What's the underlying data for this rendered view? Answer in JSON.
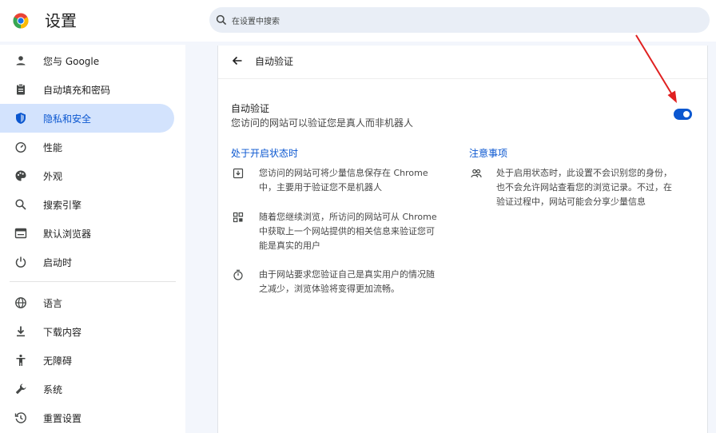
{
  "header": {
    "title": "设置",
    "search_placeholder": "在设置中搜索"
  },
  "sidebar": {
    "items": [
      {
        "label": "您与 Google",
        "icon": "person-icon"
      },
      {
        "label": "自动填充和密码",
        "icon": "clipboard-icon"
      },
      {
        "label": "隐私和安全",
        "icon": "shield-icon",
        "active": true
      },
      {
        "label": "性能",
        "icon": "speedometer-icon"
      },
      {
        "label": "外观",
        "icon": "palette-icon"
      },
      {
        "label": "搜索引擎",
        "icon": "search-icon"
      },
      {
        "label": "默认浏览器",
        "icon": "browser-window-icon"
      },
      {
        "label": "启动时",
        "icon": "power-icon"
      },
      {
        "label": "语言",
        "icon": "globe-icon"
      },
      {
        "label": "下载内容",
        "icon": "download-icon"
      },
      {
        "label": "无障碍",
        "icon": "accessibility-icon"
      },
      {
        "label": "系统",
        "icon": "wrench-icon"
      },
      {
        "label": "重置设置",
        "icon": "history-icon"
      }
    ]
  },
  "main": {
    "page_title": "自动验证",
    "setting": {
      "title": "自动验证",
      "description": "您访问的网站可以验证您是真人而非机器人",
      "enabled": true
    },
    "when_on": {
      "heading": "处于开启状态时",
      "items": [
        {
          "icon": "download-box-icon",
          "lines": [
            "您访问的网站可将少量信息保存在 Chrome",
            "中，主要用于验证您不是机器人"
          ]
        },
        {
          "icon": "grid-icon",
          "lines": [
            "随着您继续浏览，所访问的网站可从 Chrome",
            "中获取上一个网站提供的相关信息来验证您可",
            "能是真实的用户"
          ]
        },
        {
          "icon": "timer-icon",
          "lines": [
            "由于网站要求您验证自己是真实用户的情况随",
            "之减少，浏览体验将变得更加流畅。"
          ]
        }
      ]
    },
    "notes": {
      "heading": "注意事项",
      "items": [
        {
          "icon": "people-icon",
          "lines": [
            "处于启用状态时，此设置不会识别您的身份，",
            "也不会允许网站查看您的浏览记录。不过，在",
            "验证过程中，网站可能会分享少量信息"
          ]
        }
      ]
    }
  },
  "colors": {
    "accent": "#0b57d0",
    "active_nav_bg": "#d3e3fd",
    "page_bg": "#f3f6fc",
    "annotation_arrow": "#e02020"
  }
}
